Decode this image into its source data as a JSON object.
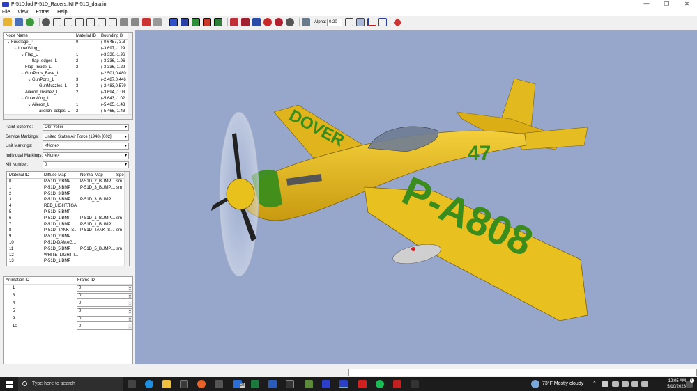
{
  "window": {
    "title": "P-51D.lod  P-51D_Racers.INI  P-51D_data.ini",
    "controls": [
      "—",
      "❐",
      "✕"
    ]
  },
  "menu": [
    "File",
    "View",
    "Extras",
    "Help"
  ],
  "toolbar": {
    "alpha_label": "Alpha:",
    "alpha_value": "0.20"
  },
  "tree": {
    "headers": [
      "Node Name",
      "Material ID",
      "Bounding B"
    ],
    "rows": [
      {
        "toggle": "⌄",
        "indent": 0,
        "name": "Fuselage_P",
        "mat": "0",
        "bb": "(-0.6457,-3.8"
      },
      {
        "toggle": "⌄",
        "indent": 1,
        "name": "InnerWing_L",
        "mat": "1",
        "bb": "(-3.697,-1.29"
      },
      {
        "toggle": "⌄",
        "indent": 2,
        "name": "Flap_L",
        "mat": "1",
        "bb": "(-3.336,-1.96"
      },
      {
        "toggle": "",
        "indent": 3,
        "name": "flap_edges_L",
        "mat": "2",
        "bb": "(-3.336,-1.96"
      },
      {
        "toggle": "",
        "indent": 2,
        "name": "Flap_Inside_L",
        "mat": "2",
        "bb": "(-3.336,-1.29"
      },
      {
        "toggle": "⌄",
        "indent": 2,
        "name": "GunPorts_Base_L",
        "mat": "1",
        "bb": "(-2.501,0.480"
      },
      {
        "toggle": "⌄",
        "indent": 3,
        "name": "GunPorts_L",
        "mat": "3",
        "bb": "(-2.487,0.446"
      },
      {
        "toggle": "",
        "indent": 4,
        "name": "GunMuzzles_L",
        "mat": "3",
        "bb": "(-2.483,0.579"
      },
      {
        "toggle": "",
        "indent": 2,
        "name": "Aileron_Inside2_L",
        "mat": "2",
        "bb": "(-3.694,-1.03"
      },
      {
        "toggle": "⌄",
        "indent": 2,
        "name": "OuterWing_L",
        "mat": "1",
        "bb": "(-5.643,-1.02"
      },
      {
        "toggle": "⌄",
        "indent": 3,
        "name": "Aileron_L",
        "mat": "1",
        "bb": "(-5.465,-1.43"
      },
      {
        "toggle": "",
        "indent": 4,
        "name": "aileron_edges_L",
        "mat": "2",
        "bb": "(-5.465,-1.43"
      }
    ]
  },
  "props": [
    {
      "label": "Paint Scheme:",
      "value": "Ole' Yeller"
    },
    {
      "label": "Service Markings:",
      "value": "United States Air Force (1948) [002]"
    },
    {
      "label": "Unit Markings:",
      "value": "<None>"
    },
    {
      "label": "Individual Markings:",
      "value": "<None>"
    },
    {
      "label": "Kill Number:",
      "value": "0"
    }
  ],
  "materials": {
    "headers": [
      "Material ID",
      "Diffuse Map",
      "Normal Map",
      "Spe"
    ],
    "rows": [
      [
        "0",
        "P-51D_2.BMP",
        "P-51D_2_BUMP....",
        "sm"
      ],
      [
        "1",
        "P-51D_3.BMP",
        "P-51D_3_BUMP....",
        "sm"
      ],
      [
        "2",
        "P-51D_3.BMP",
        "",
        ""
      ],
      [
        "3",
        "P-51D_3.BMP",
        "P-51D_3_BUMP....",
        ""
      ],
      [
        "4",
        "RED_LIGHT.TGA",
        "",
        ""
      ],
      [
        "5",
        "P-51D_5.BMP",
        "",
        ""
      ],
      [
        "6",
        "P-51D_1.BMP",
        "P-51D_1_BUMP....",
        "sm"
      ],
      [
        "7",
        "P-51D_1.BMP",
        "P-51D_1_BUMP....",
        ""
      ],
      [
        "8",
        "P-51D_TANK_S...",
        "P-51D_TANK_S...",
        "sm"
      ],
      [
        "9",
        "P-51D_2.BMP",
        "",
        ""
      ],
      [
        "10",
        "P-51D-DAMAG...",
        "",
        ""
      ],
      [
        "11",
        "P-51D_5.BMP",
        "P-51D_5_BUMP....",
        "sm"
      ],
      [
        "12",
        "WHITE_LIGHT.T...",
        "",
        ""
      ],
      [
        "13",
        "P-51D_1.BMP",
        "",
        ""
      ]
    ]
  },
  "animations": {
    "headers": [
      "Animation ID",
      "Frame ID"
    ],
    "rows": [
      {
        "id": "1",
        "frame": "0"
      },
      {
        "id": "3",
        "frame": "0"
      },
      {
        "id": "4",
        "frame": "0"
      },
      {
        "id": "5",
        "frame": "0"
      },
      {
        "id": "9",
        "frame": "0"
      },
      {
        "id": "10",
        "frame": "0"
      }
    ]
  },
  "aircraft": {
    "wing_text": "P-A808",
    "upper_wing_text": "DOVER",
    "fuselage_number": "47",
    "livery_color": "#e8c11c",
    "marking_color": "#3a8d1c",
    "background": "#97a7cc"
  },
  "taskbar": {
    "search_placeholder": "Type here to search",
    "mail_badge": "22",
    "weather": "73°F  Mostly cloudy",
    "time": "12:05 AM",
    "date": "5/10/2023",
    "notification_badge": "1"
  }
}
